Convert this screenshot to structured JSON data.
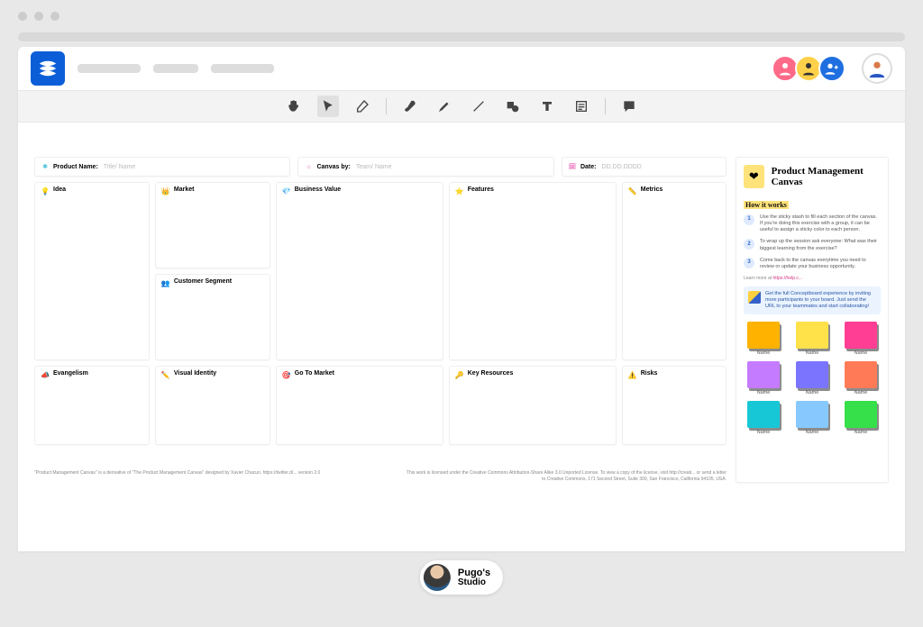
{
  "meta": {
    "product_name_label": "Product Name:",
    "product_name_placeholder": "Title/ Name",
    "canvas_by_label": "Canvas by:",
    "canvas_by_placeholder": "Team/ Name",
    "date_label": "Date:",
    "date_placeholder": "DD.DD.DDDD"
  },
  "cards": {
    "idea": "Idea",
    "market": "Market",
    "segment": "Customer Segment",
    "business_value": "Business Value",
    "features": "Features",
    "metrics": "Metrics",
    "evangelism": "Evangelism",
    "visual_identity": "Visual Identity",
    "gtm": "Go To Market",
    "key_resources": "Key Resources",
    "risks": "Risks"
  },
  "footer": {
    "left": "\"Product Management Canvas\" is a derivative of \"The Product Management Canvas\" designed by Xavier Chacun. https://twitter.d/... version 2.0",
    "right": "This work is licensed under the Creative Commons Attribution-Share Alike 3.0 Unported License. To view a copy of the license, visit http://creati... or send a letter to Creative Commons, 171 Second Street, Suite 300, San Francisco, California 94105, USA."
  },
  "side": {
    "title": "Product Management Canvas",
    "how": "How it works",
    "steps": [
      "Use the sticky stash to fill each section of the canvas. If you're doing this exercise with a group, it can be useful to assign a sticky color to each person.",
      "To wrap up the session ask everyone: What was their biggest learning from the exercise?",
      "Come back to the canvas everytime you need to review or update your business opportunity."
    ],
    "learn_prefix": "Learn more at ",
    "learn_link": "https://help.c...",
    "promo": "Get the full Conceptboard experience by inviting more participants to your board. Just send the URL to your teammates and start collaborating!",
    "palette_label": "Name",
    "colors": [
      "#ffb300",
      "#ffe14a",
      "#ff3e94",
      "#c57bff",
      "#7b74ff",
      "#ff7b57",
      "#18c7d6",
      "#87c9ff",
      "#36e04a"
    ]
  },
  "brand": {
    "name": "Pugo's",
    "sub": "Studio"
  },
  "toolbar": {
    "tools": [
      "hand",
      "select",
      "eraser",
      "brush",
      "marker",
      "line",
      "shape",
      "text",
      "note",
      "comment"
    ]
  }
}
